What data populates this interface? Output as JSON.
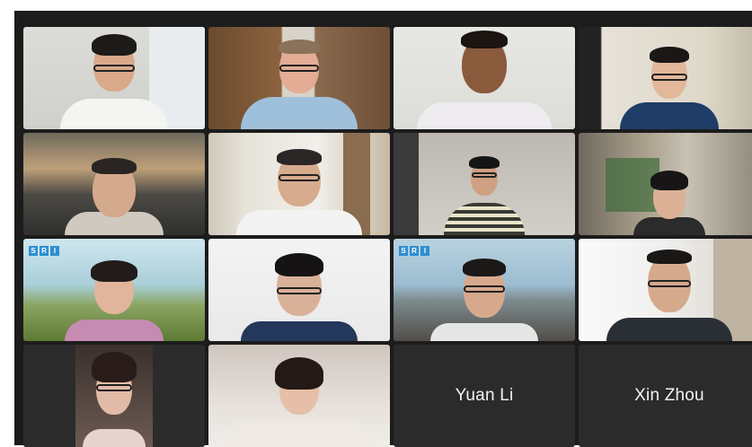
{
  "meeting": {
    "participants": [
      {
        "tile": 1,
        "label": ""
      },
      {
        "tile": 2,
        "label": ""
      },
      {
        "tile": 3,
        "label": "",
        "active_speaker": true
      },
      {
        "tile": 4,
        "label": ""
      },
      {
        "tile": 5,
        "label": ""
      },
      {
        "tile": 6,
        "label": ""
      },
      {
        "tile": 7,
        "label": ""
      },
      {
        "tile": 8,
        "label": ""
      },
      {
        "tile": 9,
        "label": ""
      },
      {
        "tile": 10,
        "label": ""
      },
      {
        "tile": 11,
        "label": ""
      },
      {
        "tile": 12,
        "label": ""
      },
      {
        "tile": 13,
        "label": ""
      },
      {
        "tile": 14,
        "label": ""
      },
      {
        "tile": 15,
        "label": "Yuan Li"
      },
      {
        "tile": 16,
        "label": "Xin Zhou"
      }
    ],
    "background_badge": "SRI",
    "colors": {
      "window_bg": "#1c1c1c",
      "tile_bg": "#2b2b2b",
      "active_outline": "#6cc06c",
      "name_text": "#f2f2f2"
    }
  }
}
